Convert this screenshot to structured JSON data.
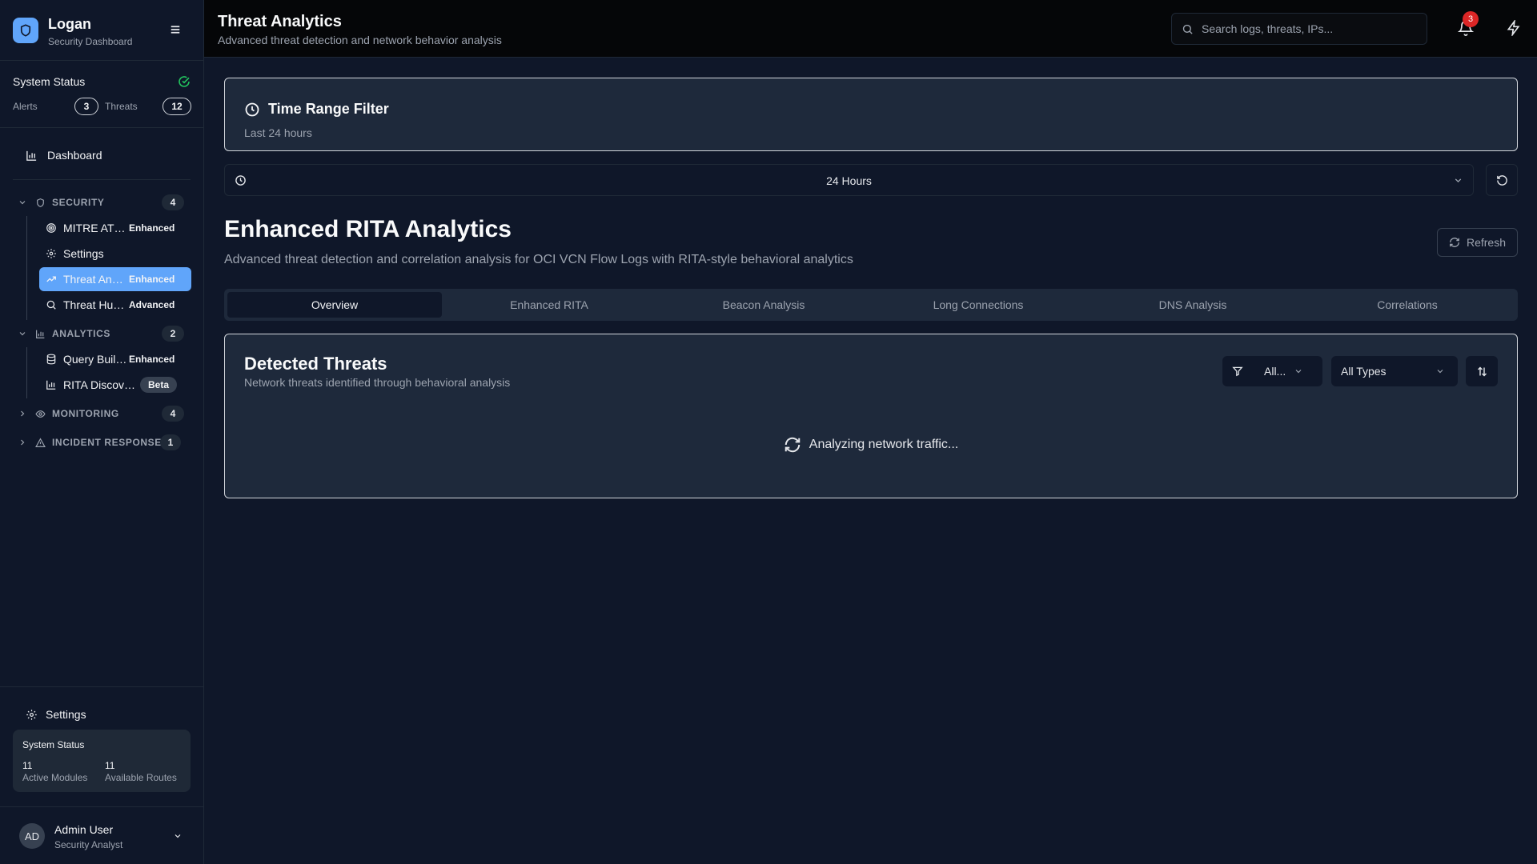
{
  "brand": {
    "name": "Logan",
    "subtitle": "Security Dashboard"
  },
  "system_status": {
    "title": "System Status",
    "alerts_label": "Alerts",
    "alerts_count": "3",
    "threats_label": "Threats",
    "threats_count": "12"
  },
  "nav": {
    "dashboard": "Dashboard",
    "sections": [
      {
        "title": "SECURITY",
        "count": "4",
        "expanded": true,
        "items": [
          {
            "label": "MITRE ATT&CK",
            "tag": "Enhanced"
          },
          {
            "label": "Settings",
            "tag": ""
          },
          {
            "label": "Threat Analytics",
            "tag": "Enhanced",
            "active": true
          },
          {
            "label": "Threat Hunting",
            "tag": "Advanced"
          }
        ]
      },
      {
        "title": "ANALYTICS",
        "count": "2",
        "expanded": true,
        "items": [
          {
            "label": "Query Builder",
            "tag": "Enhanced"
          },
          {
            "label": "RITA Discovery",
            "tag": "Beta"
          }
        ]
      },
      {
        "title": "MONITORING",
        "count": "4",
        "expanded": false
      },
      {
        "title": "INCIDENT RESPONSE",
        "count": "1",
        "expanded": false
      }
    ]
  },
  "sidebar_footer": {
    "settings": "Settings",
    "card_title": "System Status",
    "active_modules_value": "11",
    "active_modules_label": "Active Modules",
    "available_routes_value": "11",
    "available_routes_label": "Available Routes"
  },
  "user": {
    "initials": "AD",
    "name": "Admin User",
    "role": "Security Analyst"
  },
  "header": {
    "title": "Threat Analytics",
    "subtitle": "Advanced threat detection and network behavior analysis",
    "search_placeholder": "Search logs, threats, IPs...",
    "notifications": "3"
  },
  "time_filter": {
    "title": "Time Range Filter",
    "subtitle": "Last 24 hours",
    "selected": "24 Hours"
  },
  "page": {
    "title": "Enhanced RITA Analytics",
    "subtitle": "Advanced threat detection and correlation analysis for OCI VCN Flow Logs with RITA-style behavioral analytics",
    "refresh": "Refresh"
  },
  "tabs": [
    "Overview",
    "Enhanced RITA",
    "Beacon Analysis",
    "Long Connections",
    "DNS Analysis",
    "Correlations"
  ],
  "threats": {
    "title": "Detected Threats",
    "subtitle": "Network threats identified through behavioral analysis",
    "severity_filter": "All...",
    "type_filter": "All Types",
    "loading": "Analyzing network traffic..."
  },
  "colors": {
    "accent": "#60a5fa",
    "badge": "#dc2626",
    "status_ok": "#22c55e"
  }
}
